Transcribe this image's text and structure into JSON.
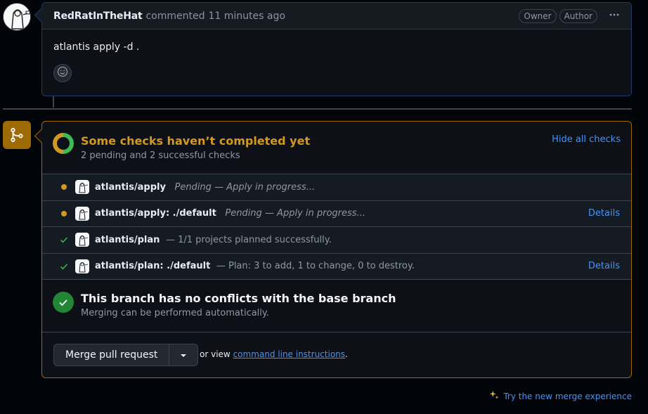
{
  "comment": {
    "author": "RedRatInTheHat",
    "action_text": "commented",
    "time": "11 minutes ago",
    "badges": [
      "Owner",
      "Author"
    ],
    "more_icon": "kebab-horizontal-icon",
    "body": "atlantis apply -d .",
    "reaction_icon": "smiley-icon"
  },
  "merge": {
    "icon": "git-merge-icon",
    "checks": {
      "title": "Some checks haven’t completed yet",
      "subtitle": "2 pending and 2 successful checks",
      "hide_link": "Hide all checks",
      "items": [
        {
          "name": "atlantis/apply",
          "status": "pending",
          "description": "Pending — Apply in progress...",
          "details": ""
        },
        {
          "name": "atlantis/apply: ./default",
          "status": "pending",
          "description": "Pending — Apply in progress...",
          "details": "Details"
        },
        {
          "name": "atlantis/plan",
          "status": "success",
          "description": "— 1/1 projects planned successfully.",
          "details": ""
        },
        {
          "name": "atlantis/plan: ./default",
          "status": "success",
          "description": "— Plan: 3 to add, 1 to change, 0 to destroy.",
          "details": "Details"
        }
      ]
    },
    "conflicts": {
      "title": "This branch has no conflicts with the base branch",
      "subtitle": "Merging can be performed automatically."
    },
    "actions": {
      "merge_button": "Merge pull request",
      "or_view_prefix": "or view",
      "cli_link": "command line instructions",
      "cli_suffix": "."
    }
  },
  "footer": {
    "try_new": "Try the new merge experience",
    "sparkle_icon": "sparkle-icon"
  },
  "colors": {
    "pending": "#d29922",
    "success": "#3fb950",
    "link": "#4493f8",
    "merge_border": "#9e6a03"
  }
}
